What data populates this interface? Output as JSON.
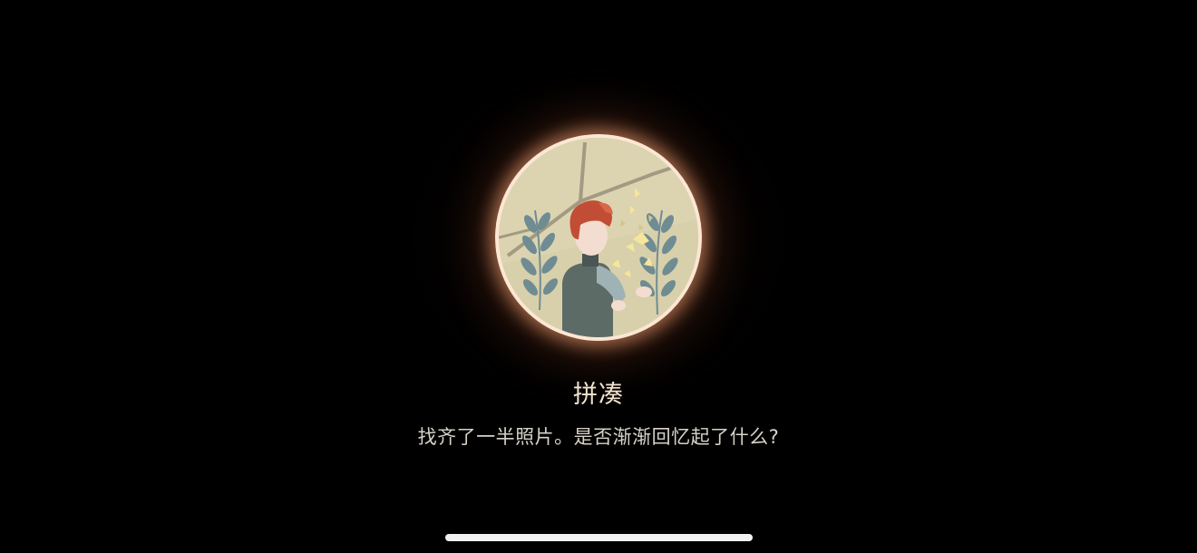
{
  "achievement": {
    "icon": "boy-with-butterflies-illustration",
    "title": "拼凑",
    "description": "找齐了一半照片。是否渐渐回忆起了什么?"
  },
  "colors": {
    "background": "#000000",
    "ring_glow": "#ffaa78",
    "ring": "#fde6d3",
    "title_text": "#f3e3cf",
    "description_text": "#d8d2c8"
  }
}
